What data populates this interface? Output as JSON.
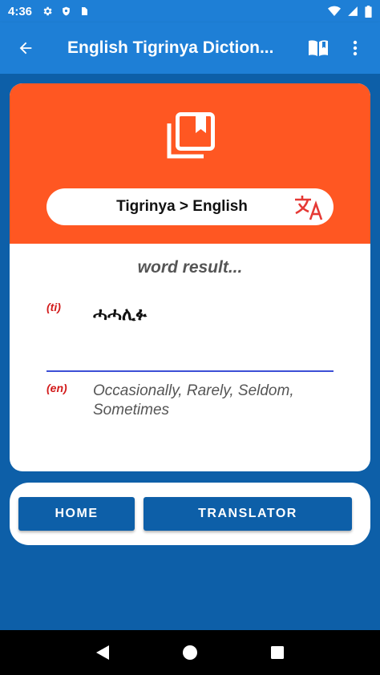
{
  "status_bar": {
    "time": "4:36",
    "left_icons": [
      "settings-icon",
      "shield-icon",
      "sim-card-icon"
    ],
    "right_icons": [
      "wifi-icon",
      "signal-icon",
      "battery-icon"
    ]
  },
  "app_bar": {
    "title": "English Tigrinya Diction...",
    "back_icon": "arrow-left-icon",
    "actions": [
      "book-open-icon",
      "more-vert-icon"
    ],
    "color": "#1e7fd6"
  },
  "card": {
    "header_color": "#ff5722",
    "dictionary_icon": "library-books-icon",
    "direction_label": "Tigrinya > English",
    "swap_icon": "translate-icon",
    "result_heading": "word result...",
    "source": {
      "tag": "(ti)",
      "word": "ሓሓሊፉ"
    },
    "target": {
      "tag": "(en)",
      "meaning": "Occasionally, Rarely, Seldom, Sometimes"
    }
  },
  "buttons": {
    "home": "HOME",
    "translator": "TRANSLATOR",
    "color": "#0d5fa8"
  },
  "nav_bar": {
    "icons": [
      "back-triangle-icon",
      "home-circle-icon",
      "recents-square-icon"
    ]
  }
}
